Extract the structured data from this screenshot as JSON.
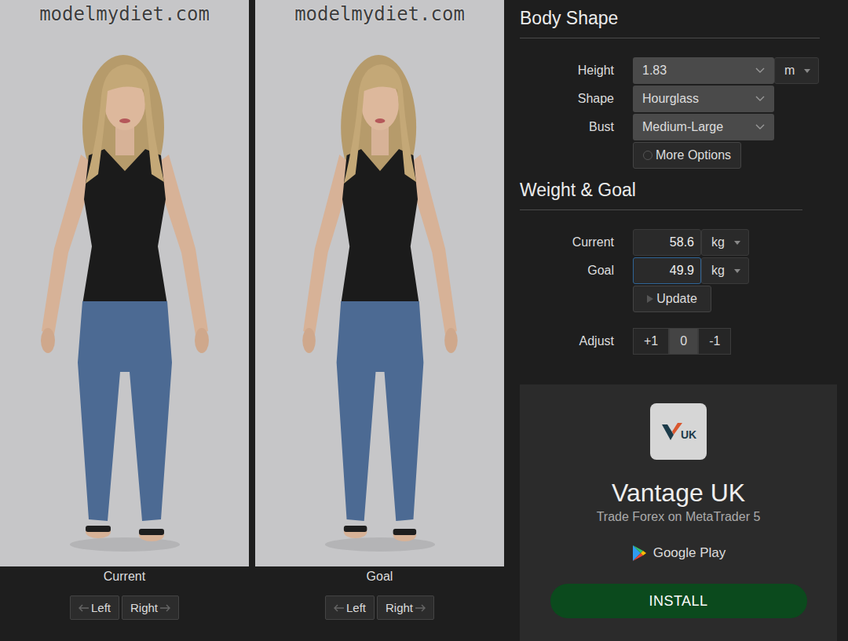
{
  "viewers": [
    {
      "watermark": "modelmydiet.com",
      "caption": "Current",
      "buttons": [
        "Left",
        "Right"
      ]
    },
    {
      "watermark": "modelmydiet.com",
      "caption": "Goal",
      "buttons": [
        "Left",
        "Right"
      ]
    }
  ],
  "body_shape": {
    "title": "Body Shape",
    "fields": [
      {
        "label": "Height",
        "value": "1.83",
        "unit": "m"
      },
      {
        "label": "Shape",
        "value": "Hourglass",
        "unit": ""
      },
      {
        "label": "Bust",
        "value": "Medium-Large",
        "unit": ""
      }
    ],
    "more_button": "More Options"
  },
  "weight_goal": {
    "title": "Weight & Goal",
    "fields": [
      {
        "label": "Current",
        "value": "58.6",
        "unit": "kg",
        "focused": false
      },
      {
        "label": "Goal",
        "value": "49.9",
        "unit": "kg",
        "focused": true
      }
    ],
    "update_button": "Update",
    "adjust": {
      "label": "Adjust",
      "options": [
        {
          "label": "+1",
          "selected": false
        },
        {
          "label": "0",
          "selected": true
        },
        {
          "label": "-1",
          "selected": false
        }
      ]
    }
  },
  "ad": {
    "brand_mark": "UK",
    "title": "Vantage UK",
    "subtitle": "Trade Forex on MetaTrader 5",
    "store": "Google Play",
    "button": "INSTALL"
  }
}
